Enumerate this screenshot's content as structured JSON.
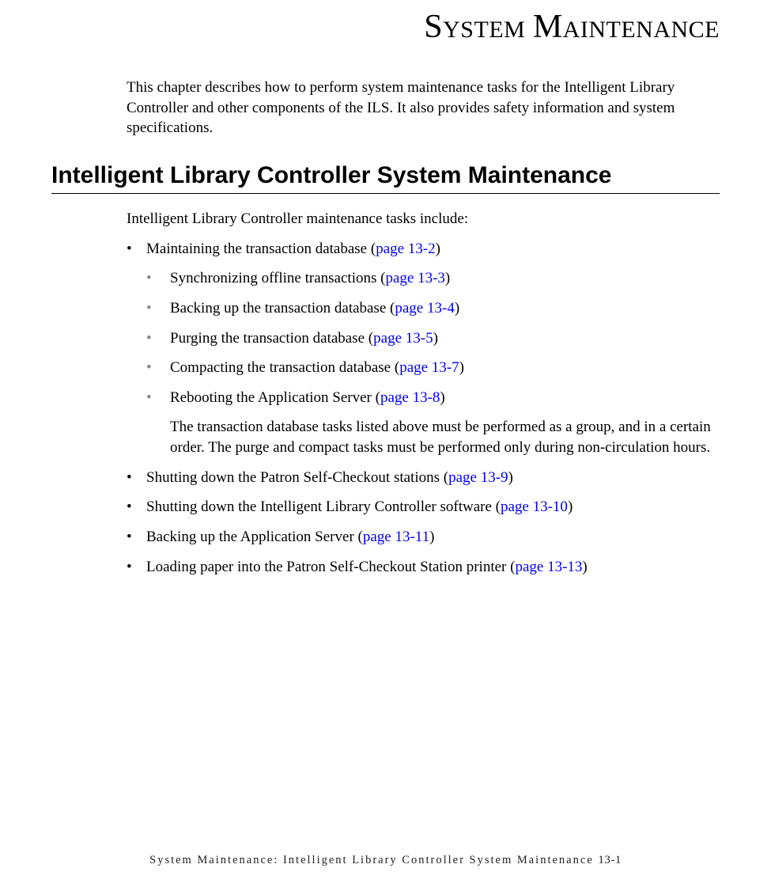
{
  "title": {
    "word1_first": "S",
    "word1_rest": "YSTEM",
    "word2_first": "M",
    "word2_rest": "AINTENANCE"
  },
  "intro": "This chapter describes how to perform system maintenance tasks for the Intelligent Library Controller and other components of the ILS. It also provides safety information and system specifications.",
  "section_heading": "Intelligent Library Controller System Maintenance",
  "list_intro": "Intelligent Library Controller maintenance tasks include:",
  "items": {
    "i0": {
      "text": "Maintaining the transaction database (",
      "link": "page 13-2",
      "close": ")"
    },
    "sub0": {
      "text": "Synchronizing offline transactions (",
      "link": "page 13-3",
      "close": ")"
    },
    "sub1": {
      "text": "Backing up the transaction database (",
      "link": "page 13-4",
      "close": ")"
    },
    "sub2": {
      "text": "Purging the transaction database (",
      "link": "page 13-5",
      "close": ")"
    },
    "sub3": {
      "text": "Compacting the transaction database (",
      "link": "page 13-7",
      "close": ")"
    },
    "sub4": {
      "text": "Rebooting the Application Server (",
      "link": "page 13-8",
      "close": ")"
    },
    "note": "The transaction database tasks listed above must be performed as a group, and in a certain order. The purge and compact tasks must be performed only during non-circulation hours.",
    "i1": {
      "text": "Shutting down the Patron Self-Checkout stations (",
      "link": "page 13-9",
      "close": ")"
    },
    "i2": {
      "text": "Shutting down the Intelligent Library Controller software (",
      "link": "page 13-10",
      "close": ")"
    },
    "i3": {
      "text": "Backing up the Application Server (",
      "link": "page 13-11",
      "close": ")"
    },
    "i4": {
      "text": "Loading paper into the Patron Self-Checkout Station printer (",
      "link": "page 13-13",
      "close": ")"
    }
  },
  "footer": {
    "text": "System Maintenance: Intelligent Library Controller System Maintenance",
    "page": "13-1"
  }
}
